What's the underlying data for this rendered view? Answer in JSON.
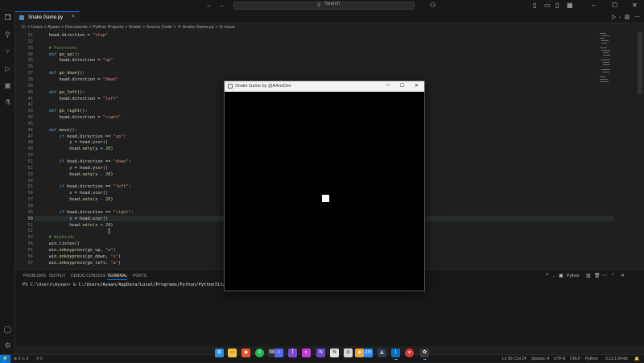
{
  "titlebar": {
    "search_label": "Search",
    "back": "←",
    "forward": "→"
  },
  "tab": {
    "filename": "Snake Game.py",
    "close": "×"
  },
  "breadcrumb": "C: > Users > Ayaan > Documents > Python Projects > Snake > Source Code > ⚘ Snake Game.py > ⌬ move",
  "editor": {
    "lines": [
      {
        "n": "31",
        "html": "    head.direction = <span class='st'>\"stop\"</span>"
      },
      {
        "n": "32",
        "html": ""
      },
      {
        "n": "33",
        "html": "    <span class='cm'># Functions</span>"
      },
      {
        "n": "34",
        "html": "    <span class='kw'>def</span> <span class='fn'>go_up</span>():"
      },
      {
        "n": "35",
        "html": "        head.direction = <span class='st'>\"up\"</span>"
      },
      {
        "n": "36",
        "html": ""
      },
      {
        "n": "37",
        "html": "    <span class='kw'>def</span> <span class='fn'>go_down</span>():"
      },
      {
        "n": "38",
        "html": "        head.direction = <span class='st'>\"down\"</span>"
      },
      {
        "n": "39",
        "html": ""
      },
      {
        "n": "40",
        "html": "    <span class='kw'>def</span> <span class='fn'>go_left</span>():"
      },
      {
        "n": "41",
        "html": "        head.direction = <span class='st'>\"left\"</span>"
      },
      {
        "n": "42",
        "html": ""
      },
      {
        "n": "43",
        "html": "    <span class='kw'>def</span> <span class='fn'>go_right</span>():"
      },
      {
        "n": "44",
        "html": "        head.direction = <span class='st'>\"right\"</span>"
      },
      {
        "n": "45",
        "html": ""
      },
      {
        "n": "46",
        "html": "    <span class='kw'>def</span> <span class='fn'>move</span>():"
      },
      {
        "n": "47",
        "html": "        <span class='kw'>if</span> head.direction == <span class='st'>\"up\"</span>:"
      },
      {
        "n": "48",
        "html": "            <span class='vr'>y</span> = head.<span class='fn'>ycor</span>()"
      },
      {
        "n": "49",
        "html": "            head.<span class='fn'>sety</span>(<span class='vr'>y</span> + <span class='nu'>20</span>)"
      },
      {
        "n": "50",
        "html": ""
      },
      {
        "n": "51",
        "html": "        <span class='kw'>if</span> head.direction == <span class='st'>\"down\"</span>:"
      },
      {
        "n": "52",
        "html": "            <span class='vr'>y</span> = head.<span class='fn'>ycor</span>()"
      },
      {
        "n": "53",
        "html": "            head.<span class='fn'>sety</span>(<span class='vr'>y</span> - <span class='nu'>20</span>)"
      },
      {
        "n": "54",
        "html": ""
      },
      {
        "n": "55",
        "html": "        <span class='kw'>if</span> head.direction == <span class='st'>\"left\"</span>:"
      },
      {
        "n": "56",
        "html": "            <span class='vr'>x</span> = head.<span class='fn'>xcor</span>()"
      },
      {
        "n": "57",
        "html": "            head.<span class='fn'>setx</span>(<span class='vr'>x</span> - <span class='nu'>20</span>)"
      },
      {
        "n": "58",
        "html": ""
      },
      {
        "n": "49",
        "html": "        <span class='kw'>if</span> head.direction == <span class='st'>\"right\"</span>:"
      },
      {
        "n": "50",
        "html": "            <span class='vr'>x</span> = head.<span class='fn'>xcor</span>()",
        "current": true
      },
      {
        "n": "51",
        "html": "            head.<span class='fn'>setx</span>(<span class='vr'>x</span> + <span class='nu'>20</span>)"
      },
      {
        "n": "52",
        "html": ""
      },
      {
        "n": "53",
        "html": "    <span class='cm'># Keybinds</span>"
      },
      {
        "n": "54",
        "html": "    win.<span class='fn'>listen</span>()"
      },
      {
        "n": "55",
        "html": "    win.<span class='fn'>onkeypress</span>(go_up, <span class='st'>\"w\"</span>)"
      },
      {
        "n": "56",
        "html": "    win.<span class='fn'>onkeypress</span>(go_down, <span class='st'>\"s\"</span>)"
      },
      {
        "n": "57",
        "html": "    win.<span class='fn'>onkeypress</span>(go_left, <span class='st'>\"a\"</span>)"
      }
    ]
  },
  "panel": {
    "tabs": [
      "PROBLEMS",
      "OUTPUT",
      "DEBUG CONSOLE",
      "TERMINAL",
      "PORTS"
    ],
    "active_tab": "TERMINAL",
    "terminal_prompt": "PS C:\\Users\\Ayaan> & ",
    "terminal_command": "C:/Users/Ayaan/AppData/Local/Programs/Python/Python313/python.exe",
    "shell_label": "Python"
  },
  "statusbar": {
    "errors": "⊗ 0 ⚠ 0",
    "ports": "⚲ 0",
    "position": "Ln 50, Col 24",
    "spaces": "Spaces: 4",
    "encoding": "UTF-8",
    "eol": "CRLF",
    "language": "Python",
    "interpreter": "3.13.1 64-bit"
  },
  "turtle_window": {
    "title": "Snake Game by @AAnnDev",
    "minimize": "–",
    "maximize": "☐",
    "close": "✕",
    "background_color": "#000000",
    "snake_color": "#ffffff"
  },
  "colors": {
    "accent": "#0078d4",
    "editor_bg": "#1f1f1f"
  }
}
